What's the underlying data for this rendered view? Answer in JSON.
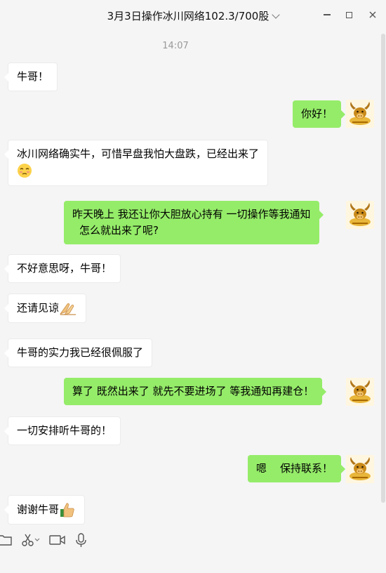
{
  "window": {
    "title": "3月3日操作冰川网络102.3/700股"
  },
  "chat": {
    "timestamp": "14:07",
    "messages": [
      {
        "side": "in",
        "text": "牛哥！"
      },
      {
        "side": "out",
        "text": "你好！"
      },
      {
        "side": "in",
        "text": "冰川网络确实牛，可惜早盘我怕大盘跌，已经出来了",
        "emoji": "embarrassed-face-emoji"
      },
      {
        "side": "out",
        "line1": "昨天晚上  我还让你大胆放心持有  一切操作等我通知",
        "line2": "怎么就出来了呢?"
      },
      {
        "side": "in",
        "text": "不好意思呀，牛哥！"
      },
      {
        "side": "in",
        "text": "还请见谅",
        "emoji": "clasped-hands-emoji"
      },
      {
        "side": "in",
        "text": "牛哥的实力我已经很佩服了"
      },
      {
        "side": "out",
        "text": "算了 既然出来了  就先不要进场了  等我通知再建仓！"
      },
      {
        "side": "in",
        "text": "一切安排听牛哥的！"
      },
      {
        "side": "out",
        "text": "嗯    保持联系！"
      },
      {
        "side": "in",
        "text": "谢谢牛哥",
        "emoji": "thumbs-up-emoji"
      }
    ]
  },
  "toolbar": {
    "icons": [
      "folder-icon",
      "scissors-icon",
      "video-call-icon",
      "microphone-icon"
    ]
  },
  "colors": {
    "outgoing_bubble": "#95ec69",
    "incoming_bubble": "#ffffff",
    "background": "#f5f5f5"
  }
}
